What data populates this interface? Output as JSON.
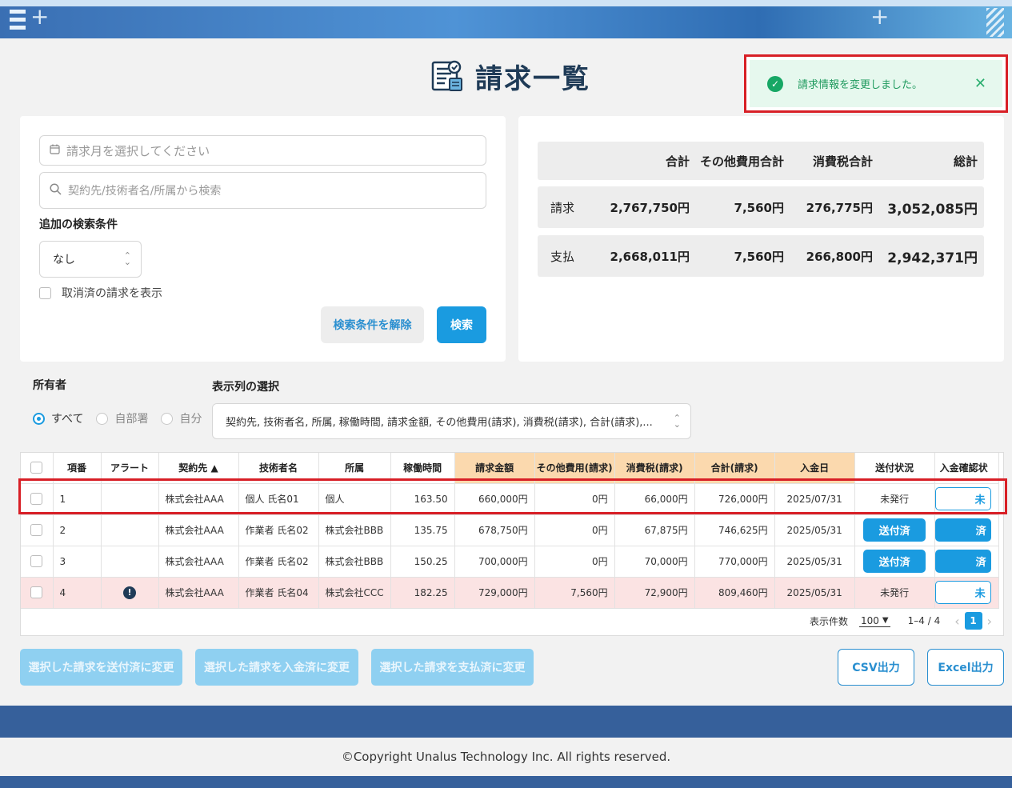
{
  "header": {
    "menu_icon": "hamburger-icon"
  },
  "page": {
    "title": "請求一覧",
    "title_icon": "invoice-document-icon"
  },
  "toast": {
    "message": "請求情報を変更しました。",
    "close": "✕",
    "check": "✓"
  },
  "search": {
    "month_placeholder": "請求月を選択してください",
    "keyword_placeholder": "契約先/技術者名/所属から検索",
    "extra_label": "追加の検索条件",
    "extra_value": "なし",
    "show_cancelled": "取消済の請求を表示",
    "clear_button": "検索条件を解除",
    "search_button": "検索"
  },
  "summary": {
    "headers": [
      "合計",
      "その他費用合計",
      "消費税合計",
      "総計"
    ],
    "rows": [
      {
        "label": "請求",
        "total": "2,767,750円",
        "other": "7,560円",
        "tax": "276,775円",
        "grand": "3,052,085円"
      },
      {
        "label": "支払",
        "total": "2,668,011円",
        "other": "7,560円",
        "tax": "266,800円",
        "grand": "2,942,371円"
      }
    ]
  },
  "owner": {
    "label": "所有者",
    "options": [
      "すべて",
      "自部署",
      "自分"
    ],
    "selected": "すべて"
  },
  "columns_select": {
    "label": "表示列の選択",
    "value": "契約先, 技術者名, 所属, 稼働時間, 請求金額, その他費用(請求), 消費税(請求), 合計(請求),..."
  },
  "table": {
    "headers": [
      "項番",
      "アラート",
      "契約先 ▲",
      "技術者名",
      "所属",
      "稼働時間",
      "請求金額",
      "その他費用(請求)",
      "消費税(請求)",
      "合計(請求)",
      "入金日",
      "送付状況",
      "入金確認状"
    ],
    "rows": [
      {
        "no": "1",
        "alert": "",
        "client": "株式会社AAA",
        "engineer": "個人 氏名01",
        "org": "個人",
        "hours": "163.50",
        "amount": "660,000円",
        "other": "0円",
        "tax": "66,000円",
        "total": "726,000円",
        "paid_date": "2025/07/31",
        "send_status": "未発行",
        "payment": "未"
      },
      {
        "no": "2",
        "alert": "",
        "client": "株式会社AAA",
        "engineer": "作業者 氏名02",
        "org": "株式会社BBB",
        "hours": "135.75",
        "amount": "678,750円",
        "other": "0円",
        "tax": "67,875円",
        "total": "746,625円",
        "paid_date": "2025/05/31",
        "send_status": "送付済",
        "payment": "済"
      },
      {
        "no": "3",
        "alert": "",
        "client": "株式会社AAA",
        "engineer": "作業者 氏名02",
        "org": "株式会社BBB",
        "hours": "150.25",
        "amount": "700,000円",
        "other": "0円",
        "tax": "70,000円",
        "total": "770,000円",
        "paid_date": "2025/05/31",
        "send_status": "送付済",
        "payment": "済"
      },
      {
        "no": "4",
        "alert": "!",
        "client": "株式会社AAA",
        "engineer": "作業者 氏名04",
        "org": "株式会社CCC",
        "hours": "182.25",
        "amount": "729,000円",
        "other": "7,560円",
        "tax": "72,900円",
        "total": "809,460円",
        "paid_date": "2025/05/31",
        "send_status": "未発行",
        "payment": "未"
      }
    ]
  },
  "pagination": {
    "per_page_label": "表示件数",
    "per_page": "100",
    "range": "1–4 / 4",
    "current_page": "1",
    "prev": "‹",
    "next": "›"
  },
  "actions": {
    "mark_sent": "選択した請求を送付済に変更",
    "mark_received": "選択した請求を入金済に変更",
    "mark_paid": "選択した請求を支払済に変更",
    "csv": "CSV出力",
    "excel": "Excel出力"
  },
  "footer": {
    "copyright": "©Copyright Unalus Technology Inc. All rights reserved."
  }
}
